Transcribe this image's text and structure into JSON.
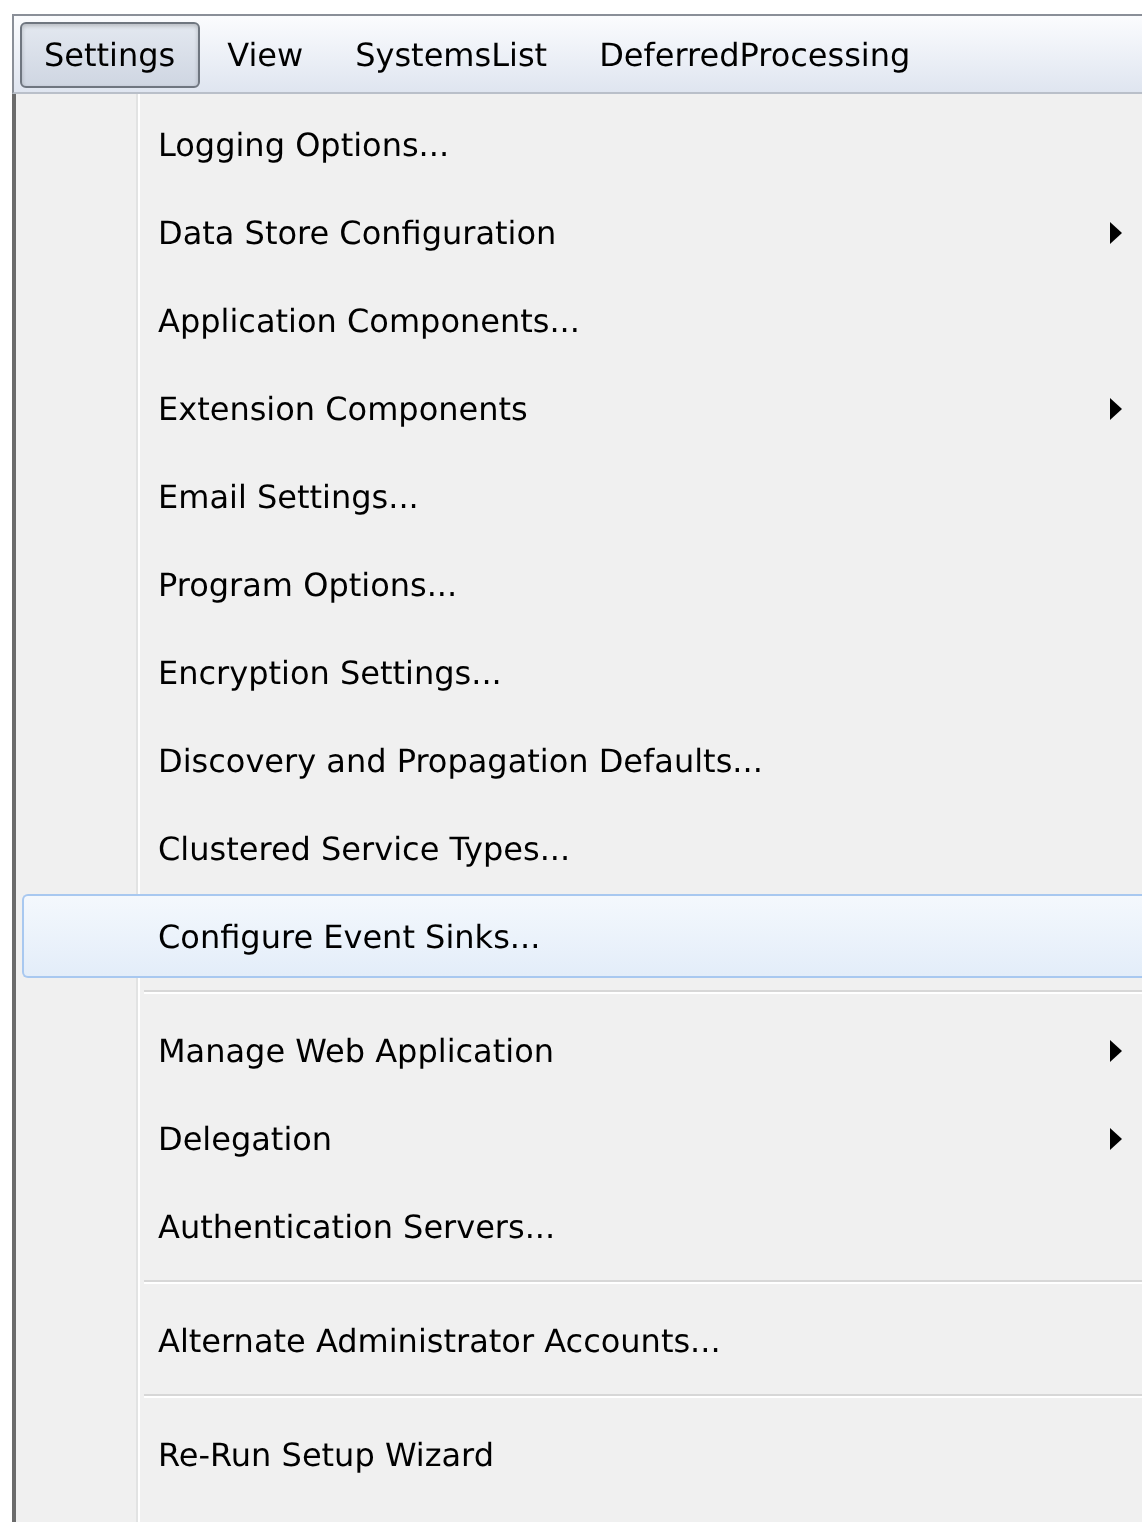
{
  "menubar": [
    {
      "label": "Settings",
      "selected": true
    },
    {
      "label": "View",
      "selected": false
    },
    {
      "label": "SystemsList",
      "selected": false
    },
    {
      "label": "DeferredProcessing",
      "selected": false
    }
  ],
  "menu": [
    {
      "kind": "item",
      "label": "Logging Options...",
      "submenu": false,
      "selected": false
    },
    {
      "kind": "item",
      "label": "Data Store Configuration",
      "submenu": true,
      "selected": false
    },
    {
      "kind": "item",
      "label": "Application Components...",
      "submenu": false,
      "selected": false
    },
    {
      "kind": "item",
      "label": "Extension Components",
      "submenu": true,
      "selected": false
    },
    {
      "kind": "item",
      "label": "Email Settings...",
      "submenu": false,
      "selected": false
    },
    {
      "kind": "item",
      "label": "Program Options...",
      "submenu": false,
      "selected": false
    },
    {
      "kind": "item",
      "label": "Encryption Settings...",
      "submenu": false,
      "selected": false
    },
    {
      "kind": "item",
      "label": "Discovery and Propagation Defaults...",
      "submenu": false,
      "selected": false
    },
    {
      "kind": "item",
      "label": "Clustered Service Types...",
      "submenu": false,
      "selected": false
    },
    {
      "kind": "item",
      "label": "Configure Event Sinks...",
      "submenu": false,
      "selected": true
    },
    {
      "kind": "separator"
    },
    {
      "kind": "item",
      "label": "Manage Web Application",
      "submenu": true,
      "selected": false
    },
    {
      "kind": "item",
      "label": "Delegation",
      "submenu": true,
      "selected": false
    },
    {
      "kind": "item",
      "label": "Authentication Servers...",
      "submenu": false,
      "selected": false
    },
    {
      "kind": "separator"
    },
    {
      "kind": "item",
      "label": "Alternate Administrator Accounts...",
      "submenu": false,
      "selected": false
    },
    {
      "kind": "separator"
    },
    {
      "kind": "item",
      "label": "Re-Run Setup Wizard",
      "submenu": false,
      "selected": false
    }
  ]
}
